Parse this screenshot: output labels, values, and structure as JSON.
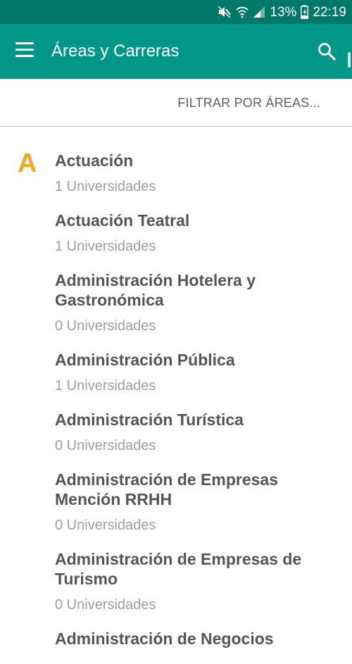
{
  "status_bar": {
    "battery": "13%",
    "time": "22:19"
  },
  "app_bar": {
    "title": "Áreas y Carreras"
  },
  "filter": {
    "label": "FILTRAR POR ÁREAS..."
  },
  "section": {
    "letter": "A"
  },
  "careers": [
    {
      "name": "Actuación",
      "count": "1 Universidades"
    },
    {
      "name": "Actuación Teatral",
      "count": "1 Universidades"
    },
    {
      "name": "Administración Hotelera y Gastronómica",
      "count": "0 Universidades"
    },
    {
      "name": "Administración Pública",
      "count": "1 Universidades"
    },
    {
      "name": "Administración Turística",
      "count": "0 Universidades"
    },
    {
      "name": "Administración de Empresas Mención RRHH",
      "count": "0 Universidades"
    },
    {
      "name": "Administración de Empresas de Turismo",
      "count": "0 Universidades"
    },
    {
      "name": "Administración de Negocios",
      "count": ""
    }
  ],
  "icons": {
    "menu": "menu-icon",
    "search": "search-icon",
    "mute": "mute-icon",
    "wifi": "wifi-icon",
    "signal": "signal-icon",
    "battery": "battery-charging-icon"
  },
  "colors": {
    "status_bar": "#00796b",
    "app_bar": "#009688",
    "section_letter": "#f5a623",
    "career_name": "#555555",
    "career_count": "#9e9e9e"
  }
}
